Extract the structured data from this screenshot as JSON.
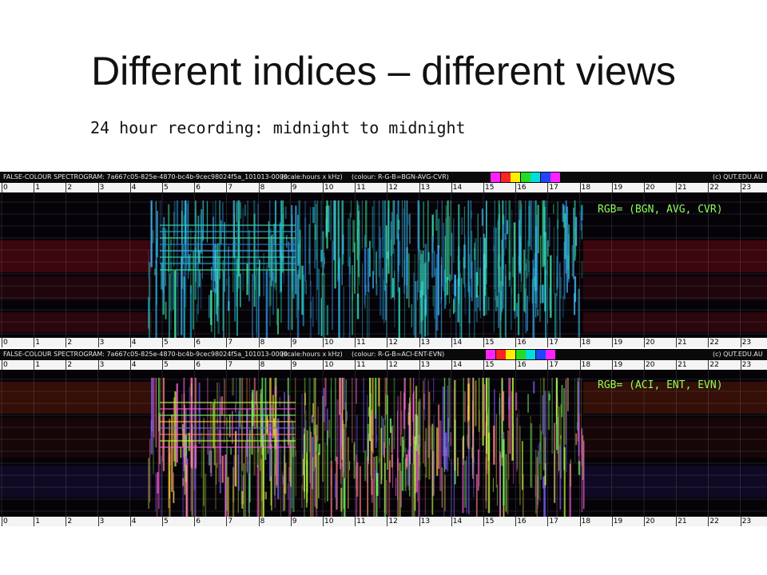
{
  "slide": {
    "title": "Different indices – different views",
    "subtitle": "24 hour recording: midnight to midnight"
  },
  "spectrogram_top": {
    "header_left": "FALSE-COLOUR SPECTROGRAM: 7a667c05-825e-4870-bc4b-9cec98024f5a_101013-0000",
    "header_scale": "(scale:hours x kHz)",
    "header_colour": "(colour: R-G-B=BGN-AVG-CVR)",
    "header_right": "(c) QUT.EDU.AU",
    "rgb_label": "RGB= (BGN, AVG, CVR)",
    "swatches": [
      "#ff22ff",
      "#ff2222",
      "#ffee00",
      "#22dd22",
      "#00dddd",
      "#2244ff",
      "#ff22ff"
    ]
  },
  "spectrogram_bottom": {
    "header_left": "FALSE-COLOUR SPECTROGRAM: 7a667c05-825e-4870-bc4b-9cec98024f5a_101013-0000",
    "header_scale": "(scale:hours x kHz)",
    "header_colour": "(colour: R-G-B=ACI-ENT-EVN)",
    "header_right": "(c) QUT.EDU.AU",
    "rgb_label": "RGB= (ACI, ENT, EVN)",
    "swatches": [
      "#ff22ff",
      "#ff2222",
      "#ffee00",
      "#22dd22",
      "#00dddd",
      "#2244ff",
      "#ff22ff"
    ]
  },
  "hours": [
    "0",
    "1",
    "2",
    "3",
    "4",
    "5",
    "6",
    "7",
    "8",
    "9",
    "10",
    "11",
    "12",
    "13",
    "14",
    "15",
    "16",
    "17",
    "18",
    "19",
    "20",
    "21",
    "22",
    "23"
  ]
}
